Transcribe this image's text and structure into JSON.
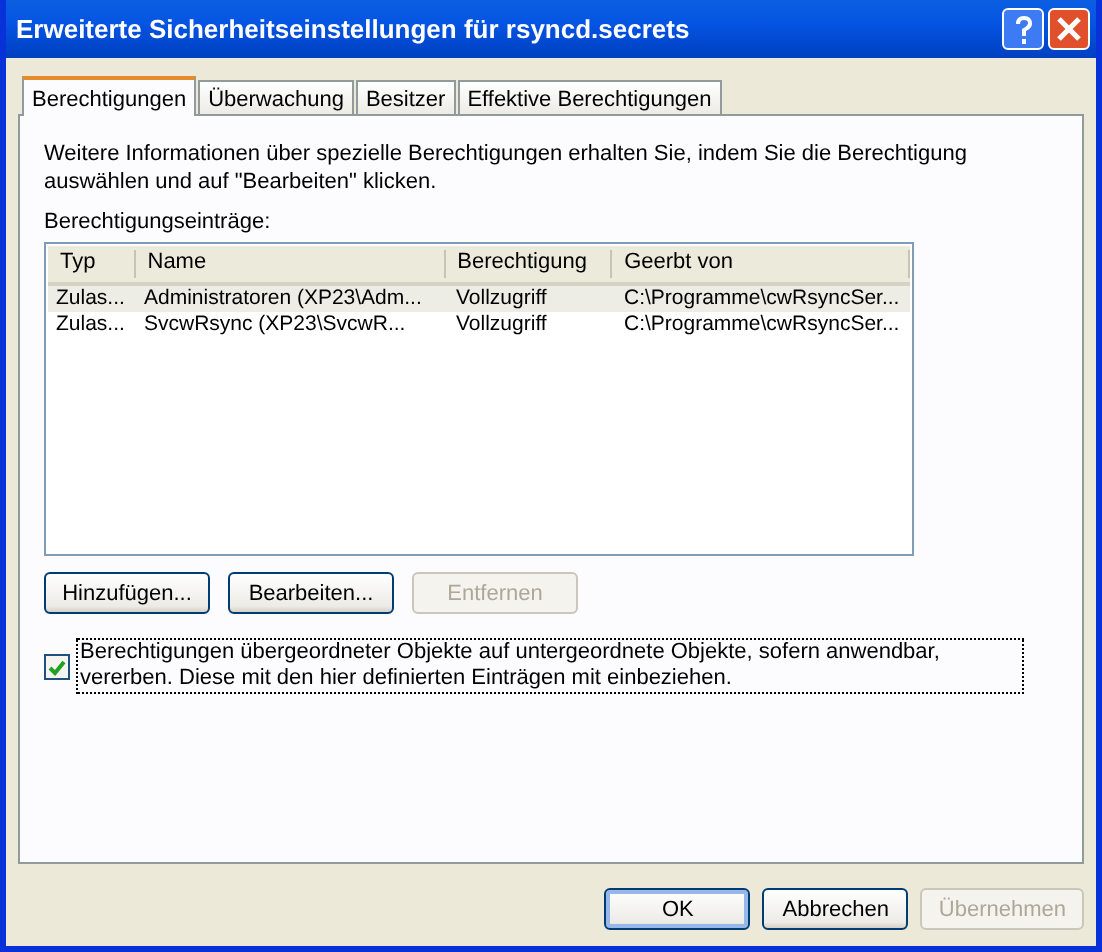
{
  "window": {
    "title": "Erweiterte Sicherheitseinstellungen für rsyncd.secrets"
  },
  "tabs": [
    {
      "label": "Berechtigungen",
      "selected": true
    },
    {
      "label": "Überwachung",
      "selected": false
    },
    {
      "label": "Besitzer",
      "selected": false
    },
    {
      "label": "Effektive Berechtigungen",
      "selected": false
    }
  ],
  "description": "Weitere Informationen über spezielle Berechtigungen erhalten Sie, indem Sie die Berechtigung auswählen und auf \"Bearbeiten\" klicken.",
  "list_label": "Berechtigungseinträge:",
  "table": {
    "columns": [
      "Typ",
      "Name",
      "Berechtigung",
      "Geerbt von"
    ],
    "rows": [
      {
        "cells": [
          "Zulas...",
          "Administratoren (XP23\\Adm...",
          "Vollzugriff",
          "C:\\Programme\\cwRsyncSer..."
        ],
        "selected": true
      },
      {
        "cells": [
          "Zulas...",
          "SvcwRsync (XP23\\SvcwR...",
          "Vollzugriff",
          "C:\\Programme\\cwRsyncSer..."
        ],
        "selected": false
      }
    ]
  },
  "list_buttons": [
    {
      "label": "Hinzufügen...",
      "disabled": false
    },
    {
      "label": "Bearbeiten...",
      "disabled": false
    },
    {
      "label": "Entfernen",
      "disabled": true
    }
  ],
  "inherit_checkbox": {
    "label": "Berechtigungen übergeordneter Objekte auf untergeordnete Objekte, sofern anwendbar, vererben. Diese mit den hier definierten Einträgen mit einbeziehen.",
    "checked": true
  },
  "dialog_buttons": [
    {
      "label": "OK",
      "disabled": false,
      "default": true
    },
    {
      "label": "Abbrechen",
      "disabled": false,
      "default": false
    },
    {
      "label": "Übernehmen",
      "disabled": true,
      "default": false
    }
  ]
}
